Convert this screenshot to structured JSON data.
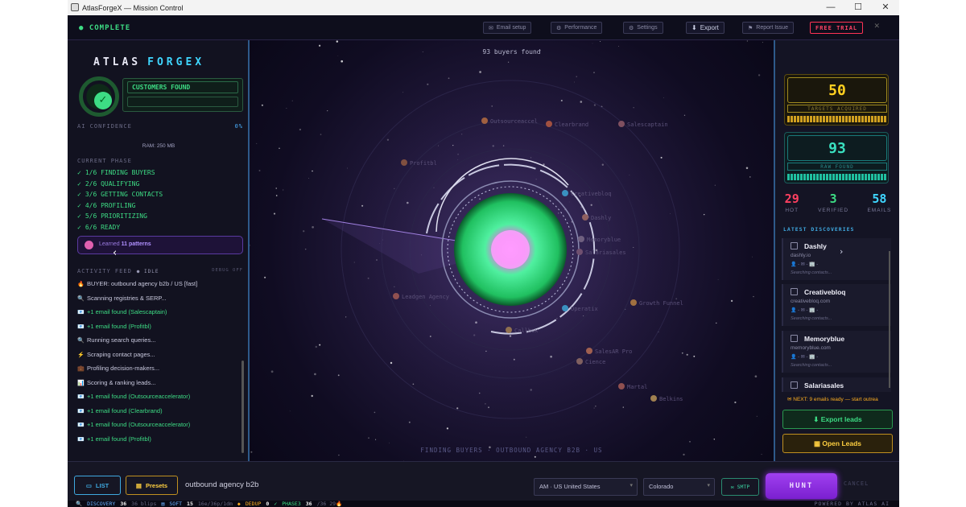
{
  "window": {
    "title": "AtlasForgeX — Mission Control",
    "minimize": "—",
    "maximize": "☐",
    "close": "✕"
  },
  "topbar": {
    "status": "COMPLETE",
    "buttons": [
      {
        "label": "Email setup",
        "icon": "mail-icon"
      },
      {
        "label": "Performance",
        "icon": "gear-icon"
      },
      {
        "label": "Settings",
        "icon": "settings-icon"
      },
      {
        "label": "Export",
        "icon": "download-icon"
      },
      {
        "label": "Report Issue",
        "icon": "flag-icon"
      }
    ],
    "trial": "FREE TRIAL",
    "close": "✕"
  },
  "left": {
    "logo_a": "ATLAS",
    "logo_b": "FORGEX",
    "customers_found": "CUSTOMERS FOUND",
    "ai_confidence": "AI CONFIDENCE",
    "ai_confidence_value": "0%",
    "ram": "RAM: 250 MB",
    "phase_header": "CURRENT PHASE",
    "phases": [
      "1/6  FINDING BUYERS",
      "2/6  QUALIFYING",
      "3/6  GETTING CONTACTS",
      "4/6  PROFILING",
      "5/6  PRIORITIZING",
      "6/6  READY"
    ],
    "learned_prefix": "Learned",
    "learned_value": "11 patterns",
    "feed_header": "ACTIVITY FEED",
    "feed_state": "IDLE",
    "debug": "DEBUG OFF",
    "feed": [
      {
        "text": "BUYER: outbound agency b2b / US [fast]",
        "icon": "🔥",
        "type": "info"
      },
      {
        "text": "Scanning registries & SERP...",
        "icon": "🔍",
        "type": "info"
      },
      {
        "text": "+1 email found (Salescaptain)",
        "icon": "📧",
        "type": "email"
      },
      {
        "text": "+1 email found (Profitbl)",
        "icon": "📧",
        "type": "email"
      },
      {
        "text": "Running search queries...",
        "icon": "🔍",
        "type": "info"
      },
      {
        "text": "Scraping contact pages...",
        "icon": "⚡",
        "type": "info"
      },
      {
        "text": "Profiling decision-makers...",
        "icon": "💼",
        "type": "info"
      },
      {
        "text": "Scoring & ranking leads...",
        "icon": "📊",
        "type": "info"
      },
      {
        "text": "+1 email found (Outsourceaccelerator)",
        "icon": "📧",
        "type": "email"
      },
      {
        "text": "+1 email found (Clearbrand)",
        "icon": "📧",
        "type": "email"
      },
      {
        "text": "+1 email found (Outsourceaccelerator)",
        "icon": "📧",
        "type": "email"
      },
      {
        "text": "+1 email found (Profitbl)",
        "icon": "📧",
        "type": "email"
      }
    ]
  },
  "center": {
    "buyers_found": "93 buyers found",
    "footer": "FINDING BUYERS  ·  OUTBOUND AGENCY B2B  ·  US",
    "node_labels": [
      "Outsourceaccel",
      "Clearbrand",
      "Salescaptain",
      "Profitbl",
      "Creativebloq",
      "Dashly",
      "Memoryblue",
      "Salariasales",
      "Leadgen Agency",
      "Callbox",
      "Operatix",
      "Growth Funnel",
      "SalesAR Pro",
      "Cience",
      "Martal",
      "Belkins"
    ]
  },
  "right": {
    "targets_value": "50",
    "targets_label": "TARGETS ACQUIRED",
    "raw_value": "93",
    "raw_label": "RAW FOUND",
    "hot": "29",
    "hot_label": "HOT",
    "verified": "3",
    "verified_label": "VERIFIED",
    "emails": "58",
    "emails_label": "EMAILS",
    "latest_header": "LATEST DISCOVERIES",
    "discoveries": [
      {
        "name": "Dashly",
        "domain": "dashly.io",
        "meta": "👤 -   ✉ -   🏢 -",
        "status": "Searching contacts..."
      },
      {
        "name": "Creativebloq",
        "domain": "creativebloq.com",
        "meta": "👤 -   ✉ -   🏢 -",
        "status": "Searching contacts..."
      },
      {
        "name": "Memoryblue",
        "domain": "memoryblue.com",
        "meta": "👤 -   ✉ -   🏢 -",
        "status": "Searching contacts..."
      },
      {
        "name": "Salariasales",
        "domain": "",
        "meta": "",
        "status": ""
      }
    ],
    "next": "NEXT: 9 emails ready — start outrea",
    "export_leads": "Export leads",
    "open_leads": "Open Leads"
  },
  "bottom": {
    "list": "LIST",
    "presets": "Presets",
    "query": "outbound agency b2b",
    "country": "AM · US  United States",
    "state": "Colorado",
    "smtp": "SMTP",
    "hunt": "HUNT",
    "cancel": "CANCEL"
  },
  "statusbar": {
    "discovery_label": "DISCOVERY",
    "discovery_value": "36",
    "discovery_note": "36 blips",
    "soft_label": "SOFT",
    "soft_value": "15",
    "soft_note": "16e/36p/1dm",
    "dedup_label": "DEDUP",
    "dedup_value": "0",
    "phase_label": "PHASE3",
    "phase_value": "36",
    "phase_note": "/36  29🔥",
    "powered": "POWERED BY ATLAS AI"
  },
  "colors": {
    "accent_green": "#3ddc84",
    "accent_cyan": "#3fd6ff",
    "hot_red": "#ff4060",
    "gold": "#ffd020",
    "hunt_purple": "#a040f0"
  }
}
